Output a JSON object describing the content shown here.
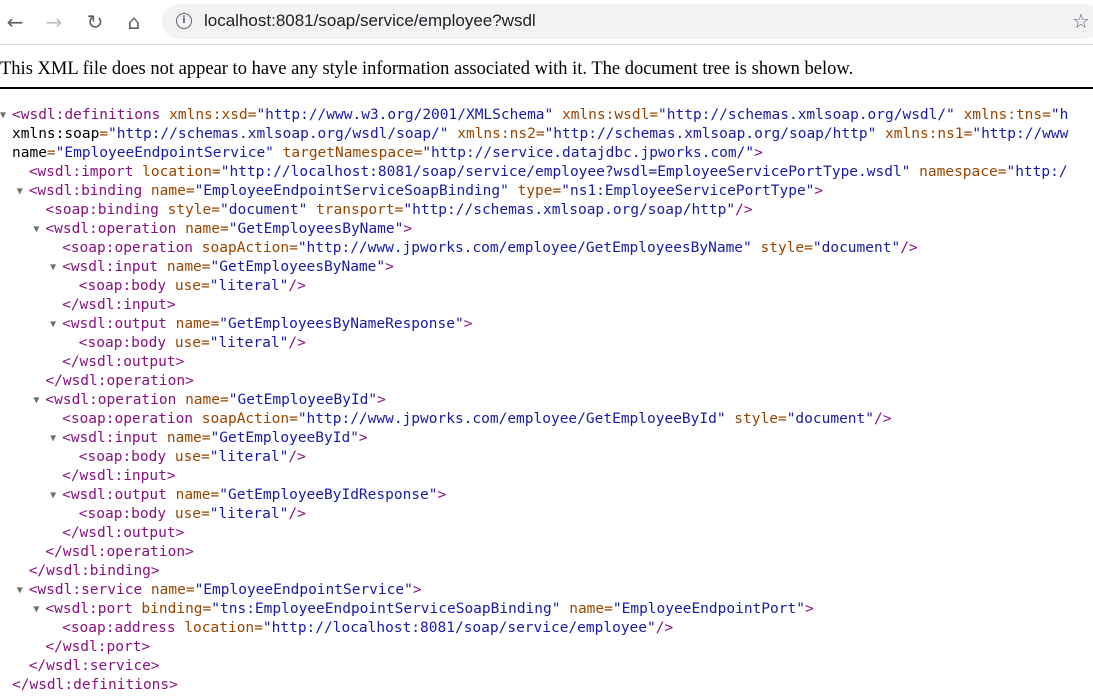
{
  "browser": {
    "url": "localhost:8081/soap/service/employee?wsdl",
    "icons": [
      "back-arrow-icon",
      "forward-arrow-icon",
      "reload-icon",
      "home-icon",
      "info-icon",
      "star-icon"
    ]
  },
  "notice": "This XML file does not appear to have any style information associated with it. The document tree is shown below.",
  "colors": {
    "tag": "#881280",
    "attr": "#994500",
    "value": "#1a1aa6"
  },
  "xml_lines": [
    {
      "depth": 0,
      "toggle": true,
      "text": "<wsdl:definitions xmlns:xsd=\"http://www.w3.org/2001/XMLSchema\" xmlns:wsdl=\"http://schemas.xmlsoap.org/wsdl/\" xmlns:tns=\"h"
    },
    {
      "depth": 0,
      "toggle": false,
      "text": "xmlns:soap=\"http://schemas.xmlsoap.org/wsdl/soap/\" xmlns:ns2=\"http://schemas.xmlsoap.org/soap/http\" xmlns:ns1=\"http://www"
    },
    {
      "depth": 0,
      "toggle": false,
      "text": "name=\"EmployeeEndpointService\" targetNamespace=\"http://service.datajdbc.jpworks.com/\">"
    },
    {
      "depth": 1,
      "toggle": false,
      "text": "<wsdl:import location=\"http://localhost:8081/soap/service/employee?wsdl=EmployeeServicePortType.wsdl\" namespace=\"http:/"
    },
    {
      "depth": 1,
      "toggle": true,
      "text": "<wsdl:binding name=\"EmployeeEndpointServiceSoapBinding\" type=\"ns1:EmployeeServicePortType\">"
    },
    {
      "depth": 2,
      "toggle": false,
      "text": "<soap:binding style=\"document\" transport=\"http://schemas.xmlsoap.org/soap/http\"/>"
    },
    {
      "depth": 2,
      "toggle": true,
      "text": "<wsdl:operation name=\"GetEmployeesByName\">"
    },
    {
      "depth": 3,
      "toggle": false,
      "text": "<soap:operation soapAction=\"http://www.jpworks.com/employee/GetEmployeesByName\" style=\"document\"/>"
    },
    {
      "depth": 3,
      "toggle": true,
      "text": "<wsdl:input name=\"GetEmployeesByName\">"
    },
    {
      "depth": 4,
      "toggle": false,
      "text": "<soap:body use=\"literal\"/>"
    },
    {
      "depth": 3,
      "toggle": false,
      "text": "</wsdl:input>"
    },
    {
      "depth": 3,
      "toggle": true,
      "text": "<wsdl:output name=\"GetEmployeesByNameResponse\">"
    },
    {
      "depth": 4,
      "toggle": false,
      "text": "<soap:body use=\"literal\"/>"
    },
    {
      "depth": 3,
      "toggle": false,
      "text": "</wsdl:output>"
    },
    {
      "depth": 2,
      "toggle": false,
      "text": "</wsdl:operation>"
    },
    {
      "depth": 2,
      "toggle": true,
      "text": "<wsdl:operation name=\"GetEmployeeById\">"
    },
    {
      "depth": 3,
      "toggle": false,
      "text": "<soap:operation soapAction=\"http://www.jpworks.com/employee/GetEmployeeById\" style=\"document\"/>"
    },
    {
      "depth": 3,
      "toggle": true,
      "text": "<wsdl:input name=\"GetEmployeeById\">"
    },
    {
      "depth": 4,
      "toggle": false,
      "text": "<soap:body use=\"literal\"/>"
    },
    {
      "depth": 3,
      "toggle": false,
      "text": "</wsdl:input>"
    },
    {
      "depth": 3,
      "toggle": true,
      "text": "<wsdl:output name=\"GetEmployeeByIdResponse\">"
    },
    {
      "depth": 4,
      "toggle": false,
      "text": "<soap:body use=\"literal\"/>"
    },
    {
      "depth": 3,
      "toggle": false,
      "text": "</wsdl:output>"
    },
    {
      "depth": 2,
      "toggle": false,
      "text": "</wsdl:operation>"
    },
    {
      "depth": 1,
      "toggle": false,
      "text": "</wsdl:binding>"
    },
    {
      "depth": 1,
      "toggle": true,
      "text": "<wsdl:service name=\"EmployeeEndpointService\">"
    },
    {
      "depth": 2,
      "toggle": true,
      "text": "<wsdl:port binding=\"tns:EmployeeEndpointServiceSoapBinding\" name=\"EmployeeEndpointPort\">"
    },
    {
      "depth": 3,
      "toggle": false,
      "text": "<soap:address location=\"http://localhost:8081/soap/service/employee\"/>"
    },
    {
      "depth": 2,
      "toggle": false,
      "text": "</wsdl:port>"
    },
    {
      "depth": 1,
      "toggle": false,
      "text": "</wsdl:service>"
    },
    {
      "depth": 0,
      "toggle": false,
      "text": "</wsdl:definitions>"
    }
  ]
}
